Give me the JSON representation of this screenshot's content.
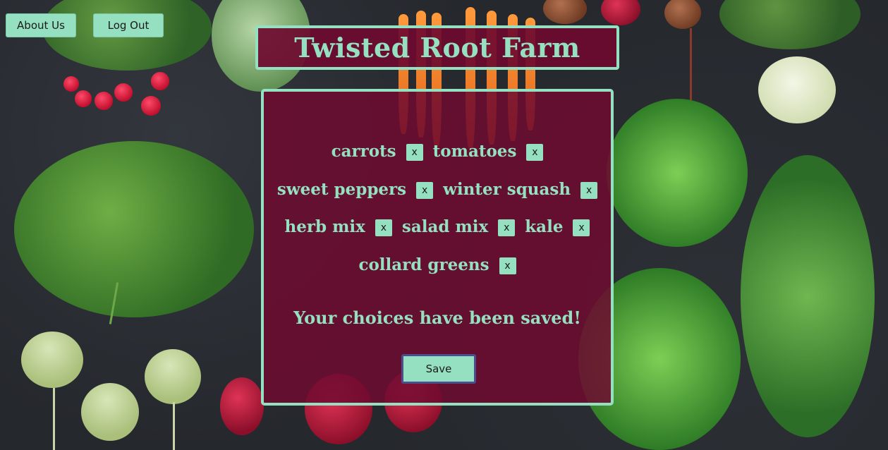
{
  "nav": {
    "about_label": "About Us",
    "logout_label": "Log Out"
  },
  "header": {
    "title": "Twisted Root Farm"
  },
  "choices": {
    "rows": [
      [
        "carrots",
        "tomatoes"
      ],
      [
        "sweet peppers",
        "winter squash"
      ],
      [
        "herb mix",
        "salad mix",
        "kale"
      ],
      [
        "collard greens"
      ]
    ],
    "remove_label": "x"
  },
  "status": {
    "message": "Your choices have been saved!"
  },
  "actions": {
    "save_label": "Save"
  },
  "colors": {
    "accent": "#95e0c0",
    "panel": "#6e0a30",
    "save_border": "#4b4e8a"
  }
}
